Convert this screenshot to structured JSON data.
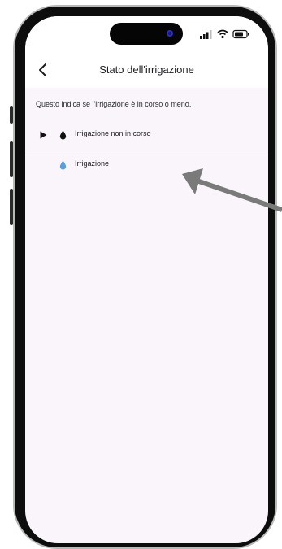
{
  "header": {
    "title": "Stato dell'irrigazione"
  },
  "main": {
    "description": "Questo indica se l'irrigazione è in corso o meno.",
    "items": [
      {
        "label": "Irrigazione non in corso",
        "icon": "water-drop-icon",
        "icon_color": "#111111",
        "expand_icon": "play-arrow-icon"
      },
      {
        "label": "Irrigazione",
        "icon": "water-drop-icon",
        "icon_color": "#5a9ee0"
      }
    ]
  },
  "colors": {
    "screen_background": "#f9f5fb",
    "appbar_background": "#ffffff",
    "annotation_arrow": "#7a7a7a"
  }
}
